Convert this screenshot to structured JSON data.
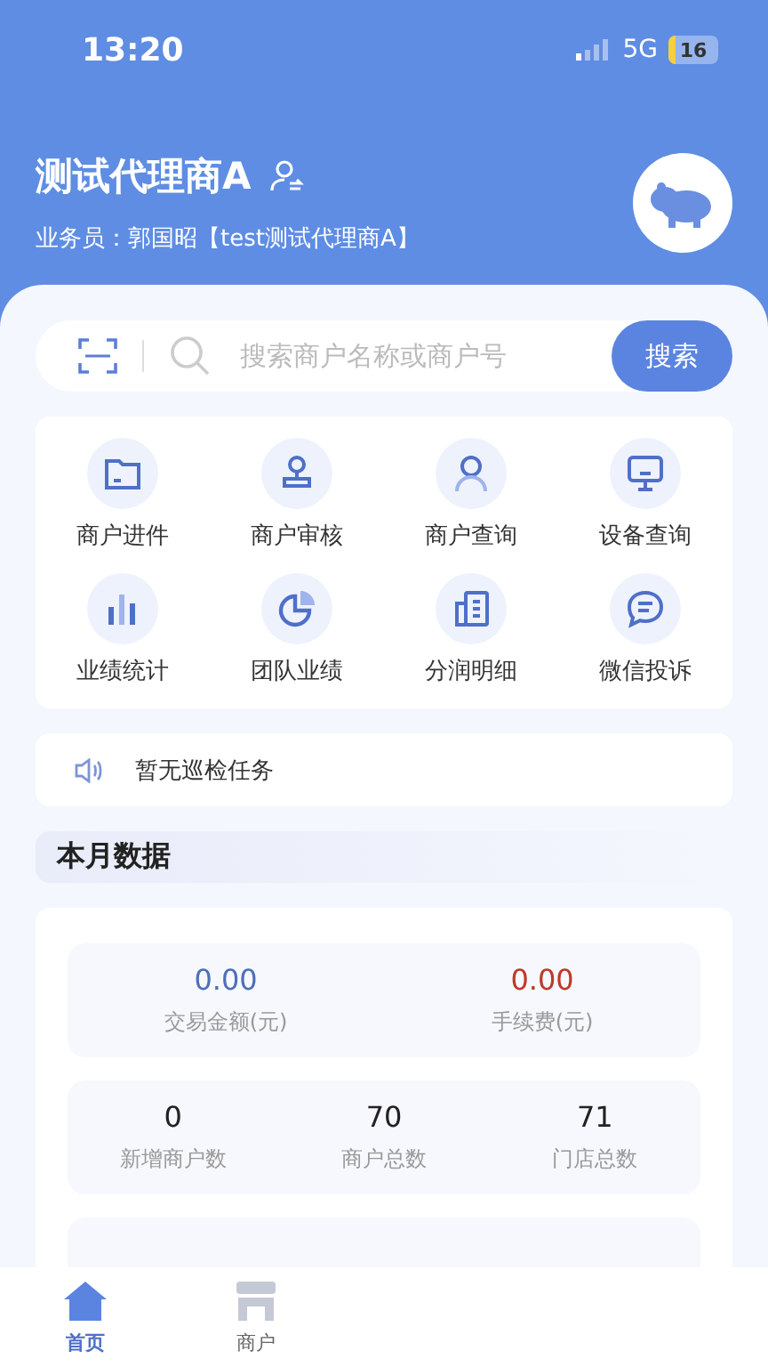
{
  "status_bar": {
    "time": "13:20",
    "network": "5G",
    "battery": "16"
  },
  "header": {
    "title": "测试代理商A",
    "subtitle": "业务员：郭国昭【test测试代理商A】"
  },
  "search": {
    "placeholder": "搜索商户名称或商户号",
    "button": "搜索"
  },
  "shortcuts": [
    {
      "label": "商户进件",
      "kind": "folder"
    },
    {
      "label": "商户审核",
      "kind": "stamp"
    },
    {
      "label": "商户查询",
      "kind": "person"
    },
    {
      "label": "设备查询",
      "kind": "monitor"
    },
    {
      "label": "业绩统计",
      "kind": "bars"
    },
    {
      "label": "团队业绩",
      "kind": "pie"
    },
    {
      "label": "分润明细",
      "kind": "document"
    },
    {
      "label": "微信投诉",
      "kind": "chat"
    }
  ],
  "notice": {
    "text": "暂无巡检任务"
  },
  "section": {
    "title": "本月数据"
  },
  "stat_groups": [
    [
      {
        "value": "0.00",
        "label": "交易金额(元)",
        "color": "#4f6fb8"
      },
      {
        "value": "0.00",
        "label": "手续费(元)",
        "color": "#c0392b"
      }
    ],
    [
      {
        "value": "0",
        "label": "新增商户数",
        "color": "#222222"
      },
      {
        "value": "70",
        "label": "商户总数",
        "color": "#222222"
      },
      {
        "value": "71",
        "label": "门店总数",
        "color": "#222222"
      }
    ]
  ],
  "cut_off_panel": true,
  "tab_bar": [
    {
      "label": "首页",
      "kind": "home",
      "selected": true
    },
    {
      "label": "商户",
      "kind": "store",
      "selected": false
    }
  ]
}
